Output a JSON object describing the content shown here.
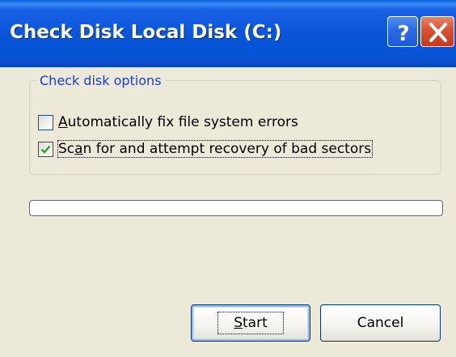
{
  "window": {
    "title": "Check Disk Local Disk (C:)",
    "help_button": "?",
    "close_button": "X"
  },
  "options": {
    "group_label": "Check disk options",
    "items": [
      {
        "label_underlined": "A",
        "label_rest": "utomatically fix file system errors",
        "checked": false
      },
      {
        "label_before": "Sc",
        "label_underlined": "a",
        "label_rest": "n for and attempt recovery of bad sectors",
        "checked": true
      }
    ]
  },
  "progress": {
    "value": 0
  },
  "buttons": {
    "start_underlined": "S",
    "start_rest": "tart",
    "cancel": "Cancel"
  },
  "colors": {
    "titlebar": "#0a55d9",
    "group_label": "#1c3ec8",
    "check_mark": "#21a121",
    "close_button": "#d9512f"
  }
}
